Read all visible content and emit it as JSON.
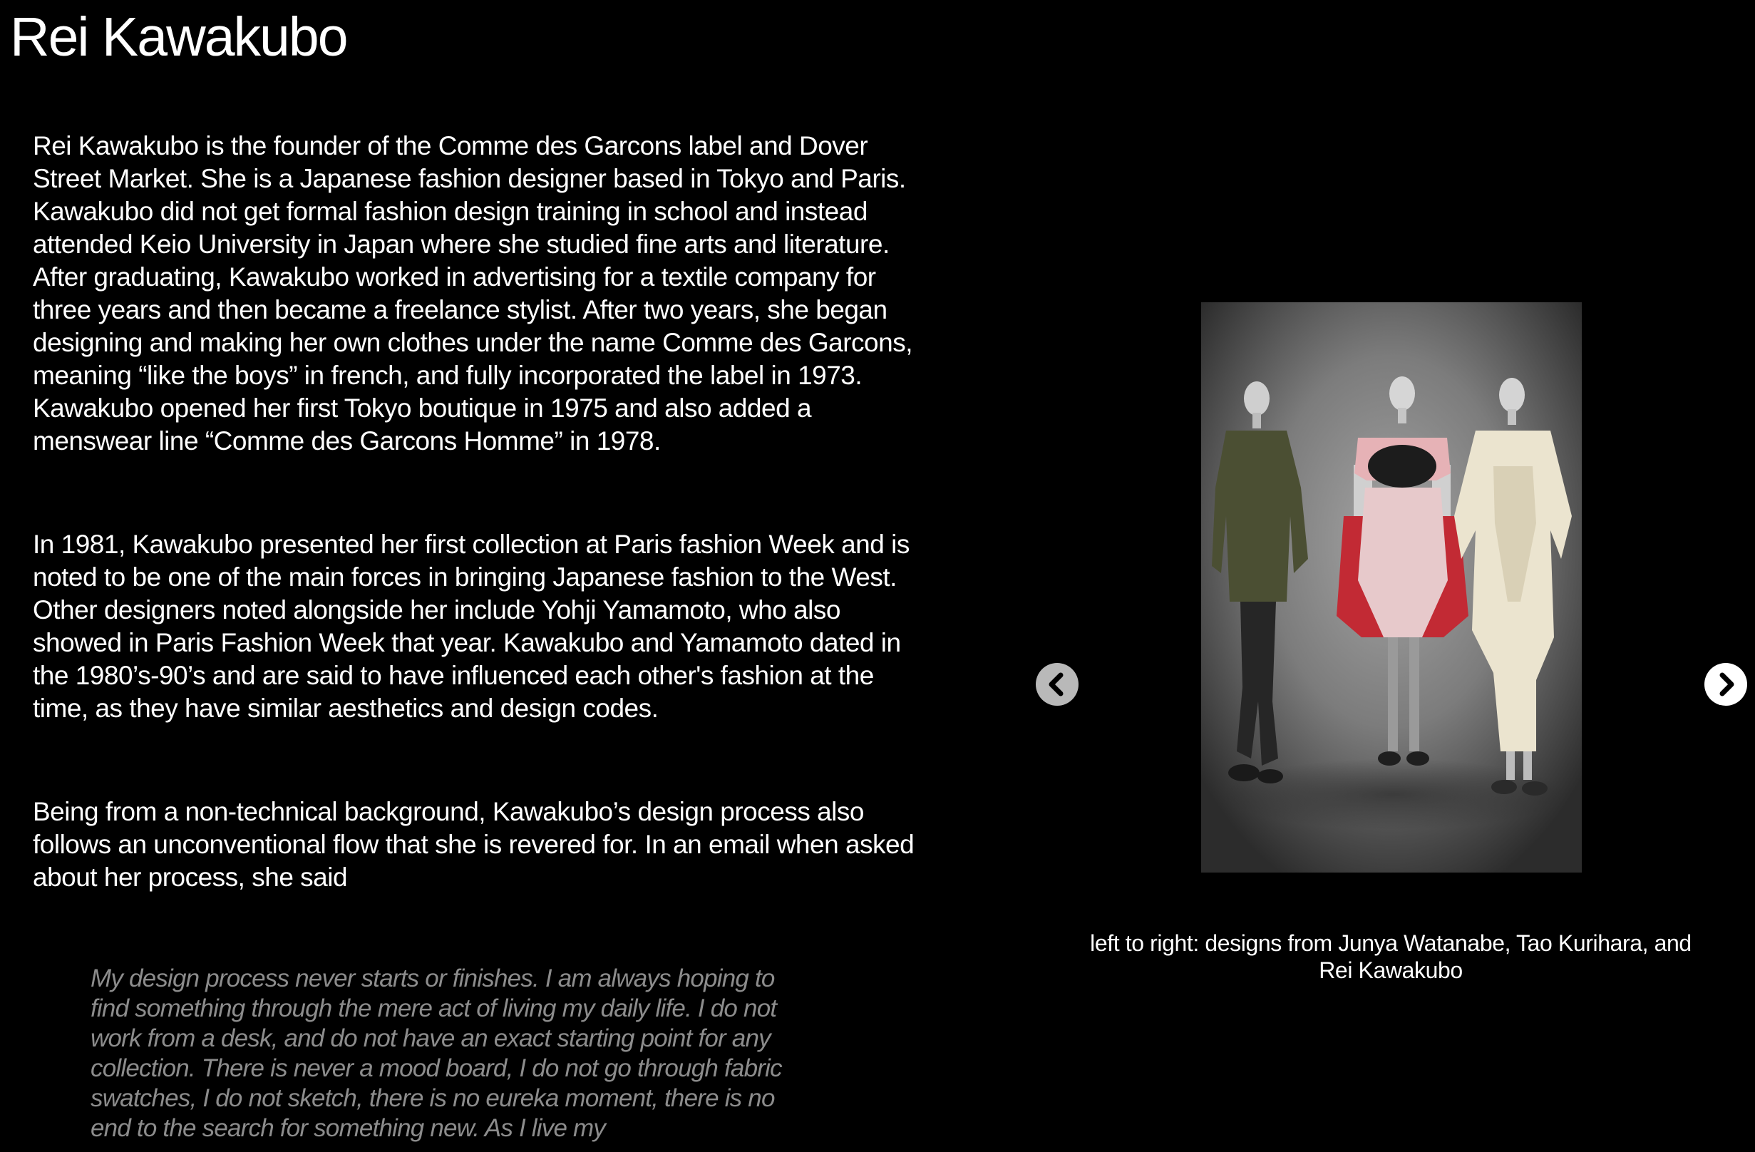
{
  "page": {
    "title": "Rei Kawakubo"
  },
  "bio": {
    "paragraphs": [
      "Rei Kawakubo is the founder of the Comme des Garcons label and Dover Street Market. She is a Japanese fashion designer based in Tokyo and Paris. Kawakubo did not get formal fashion design training in school and instead attended Keio University in Japan where she studied fine arts and literature. After graduating, Kawakubo worked in advertising for a textile company for three years and then became a freelance stylist. After two years, she began designing and making her own clothes under the name Comme des Garcons, meaning “like the boys” in french, and fully incorporated the label in 1973. Kawakubo opened her first Tokyo boutique in 1975 and also added a menswear line “Comme des Garcons Homme” in 1978.",
      "In 1981, Kawakubo presented her first collection at Paris fashion Week and is noted to be one of the main forces in bringing Japanese fashion to the West. Other designers noted alongside her include Yohji Yamamoto, who also showed in Paris Fashion Week that year. Kawakubo and Yamamoto dated in the 1980’s-90’s and are said to have influenced each other's fashion at the time, as they have similar aesthetics and design codes.",
      "Being from a non-technical background, Kawakubo’s design process also follows an unconventional flow that she is revered for. In an email when asked about her process, she said"
    ],
    "quote": "My design process never starts or finishes. I am always hoping to find something through the mere act of living my daily life. I do not work from a desk, and do not have an exact starting point for any collection. There is never a mood board, I do not go through fabric swatches, I do not sketch, there is no eureka moment, there is no end to the search for something new. As I live my"
  },
  "carousel": {
    "prev_icon": "chevron-left-icon",
    "next_icon": "chevron-right-icon",
    "caption_line1": "left to right: designs from Junya Watanabe, Tao Kurihara, and",
    "caption_line2": "Rei Kawakubo"
  },
  "colors": {
    "background": "#000000",
    "text": "#ffffff",
    "quote_text": "#8c8c8c",
    "prev_button": "#b9b9b9",
    "next_button": "#ffffff"
  }
}
